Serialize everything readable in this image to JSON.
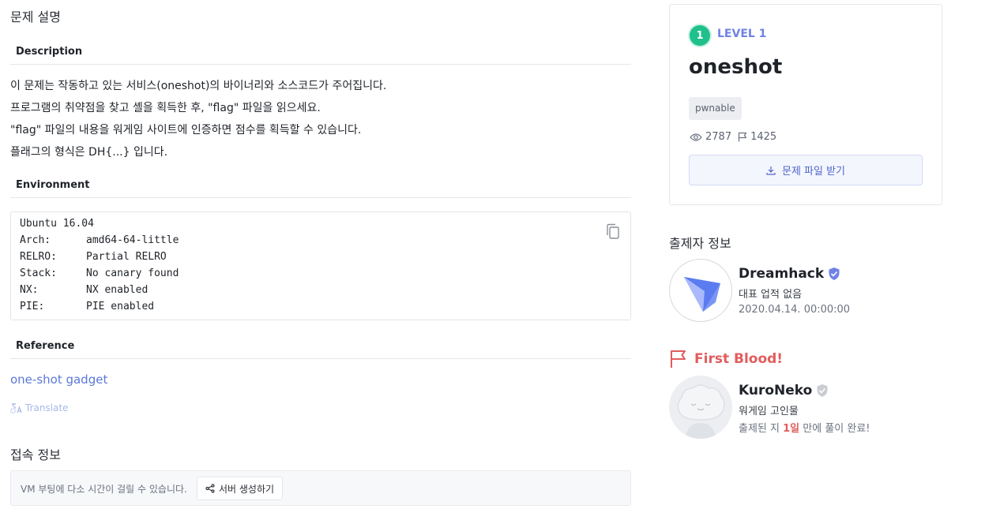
{
  "page": {
    "title": "문제 설명"
  },
  "sections": {
    "description": "Description",
    "environment": "Environment",
    "reference": "Reference"
  },
  "description_lines": [
    "이 문제는 작동하고 있는 서비스(oneshot)의 바이너리와 소스코드가 주어집니다.",
    "프로그램의 취약점을 찾고 셸을 획득한 후, \"flag\" 파일을 읽으세요.",
    "\"flag\" 파일의 내용을 워게임 사이트에 인증하면 점수를 획득할 수 있습니다.",
    "플래그의 형식은 DH{...} 입니다."
  ],
  "environment": {
    "os": "Ubuntu 16.04",
    "rows": [
      {
        "key": "Arch:",
        "value": "amd64-64-little"
      },
      {
        "key": "RELRO:",
        "value": "Partial RELRO"
      },
      {
        "key": "Stack:",
        "value": "No canary found"
      },
      {
        "key": "NX:",
        "value": "NX enabled"
      },
      {
        "key": "PIE:",
        "value": "PIE enabled"
      }
    ]
  },
  "reference": {
    "link_text": "one-shot gadget",
    "translate_label": "Translate"
  },
  "connection": {
    "title": "접속 정보",
    "message": "VM 부팅에 다소 시간이 걸릴 수 있습니다.",
    "server_button": "서버 생성하기"
  },
  "challenge": {
    "level_number": "1",
    "level_label": "LEVEL 1",
    "name": "oneshot",
    "tag": "pwnable",
    "views": "2787",
    "solves": "1425",
    "download_button": "문제 파일 받기",
    "accent_color": "#6f82e6",
    "level_color": "#1fc08b"
  },
  "author": {
    "section_title": "출제자 정보",
    "name": "Dreamhack",
    "subtitle": "대표 업적 없음",
    "date": "2020.04.14. 00:00:00"
  },
  "first_blood": {
    "title": "First Blood!",
    "name": "KuroNeko",
    "subtitle": "워게임 고인물",
    "solved_prefix": "출제된 지",
    "solved_days": "1일",
    "solved_suffix": "만에 풀이 완료!",
    "color": "#e25c5c"
  }
}
